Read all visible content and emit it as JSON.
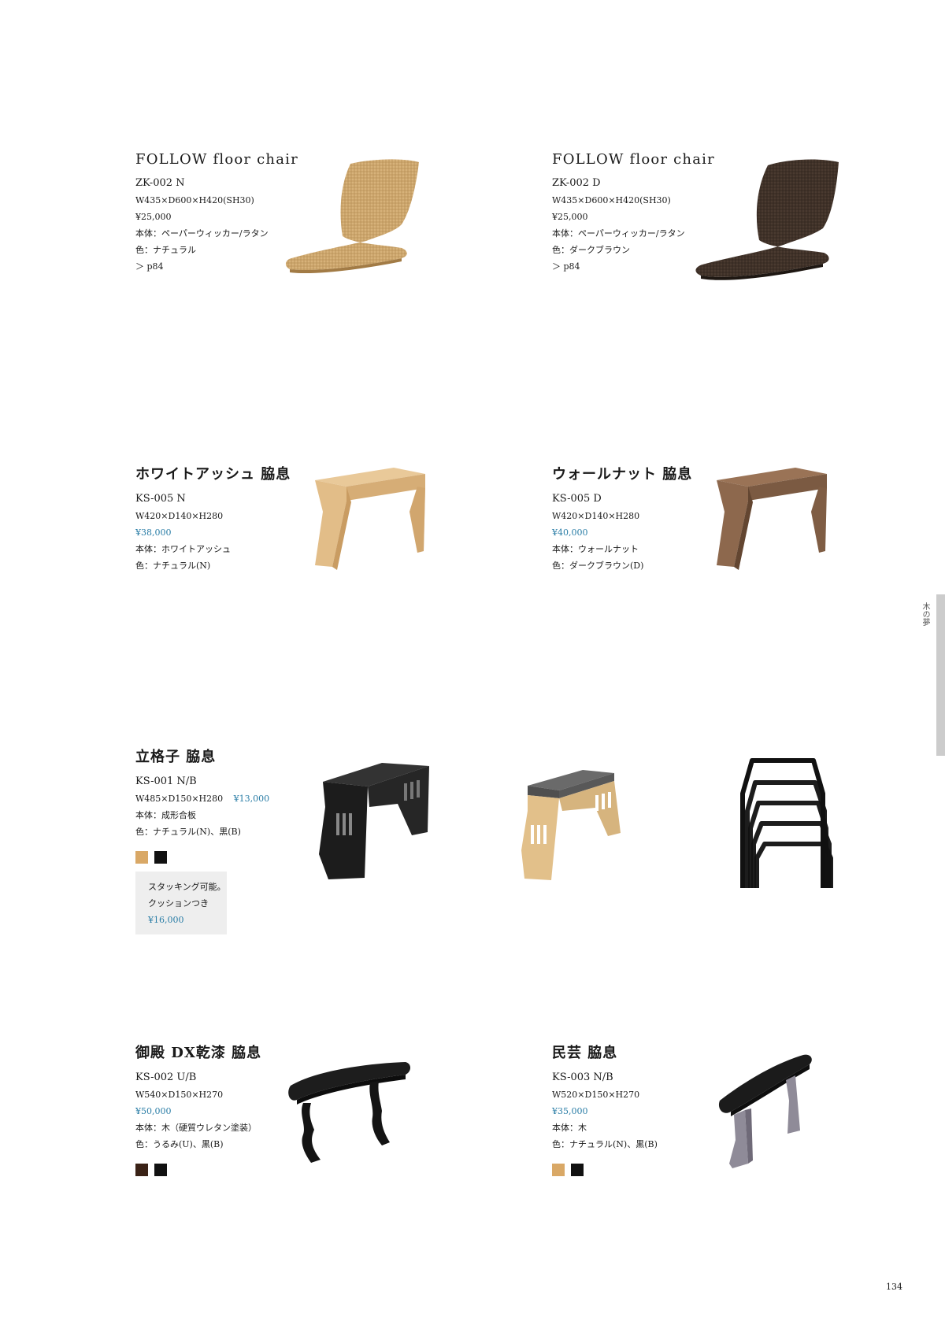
{
  "products": {
    "zk002n": {
      "title": "FOLLOW floor chair",
      "code": "ZK-002 N",
      "size": "W435×D600×H420(SH30)",
      "price": "¥25,000",
      "material": "本体：ペーパーウィッカー/ラタン",
      "color": "色：ナチュラル",
      "ref": "＞ p84"
    },
    "zk002d": {
      "title": "FOLLOW floor chair",
      "code": "ZK-002 D",
      "size": "W435×D600×H420(SH30)",
      "price": "¥25,000",
      "material": "本体：ペーパーウィッカー/ラタン",
      "color": "色：ダークブラウン",
      "ref": "＞ p84"
    },
    "ks005n": {
      "title": "ホワイトアッシュ 脇息",
      "code": "KS-005 N",
      "size": "W420×D140×H280",
      "price": "¥38,000",
      "material": "本体：ホワイトアッシュ",
      "color": "色：ナチュラル(N)"
    },
    "ks005d": {
      "title": "ウォールナット 脇息",
      "code": "KS-005 D",
      "size": "W420×D140×H280",
      "price": "¥40,000",
      "material": "本体：ウォールナット",
      "color": "色：ダークブラウン(D)"
    },
    "ks001": {
      "title": "立格子 脇息",
      "code": "KS-001 N/B",
      "size": "W485×D150×H280",
      "price": "¥13,000",
      "material": "本体：成形合板",
      "color": "色：ナチュラル(N)、黒(B)",
      "note": [
        "スタッキング可能。",
        "クッションつき",
        "¥16,000"
      ]
    },
    "ks002": {
      "title": "御殿 DX乾漆 脇息",
      "code": "KS-002 U/B",
      "size": "W540×D150×H270",
      "price": "¥50,000",
      "material": "本体：木（硬質ウレタン塗装）",
      "color": "色：うるみ(U)、黒(B)"
    },
    "ks003": {
      "title": "民芸 脇息",
      "code": "KS-003 N/B",
      "size": "W520×D150×H270",
      "price": "¥35,000",
      "material": "本体：木",
      "color": "色：ナチュラル(N)、黒(B)"
    }
  },
  "swatch_colors": {
    "natural": "#d9a866",
    "black": "#111111",
    "urumi": "#3a2216"
  },
  "colors": {
    "price_blue": "#2a7da6",
    "side_tab": "#cccccc"
  },
  "side_label": "木の夢",
  "page_number": "134"
}
